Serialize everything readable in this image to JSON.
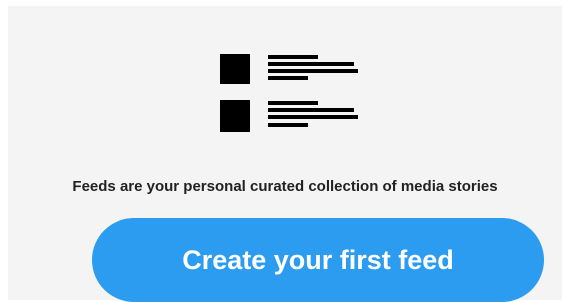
{
  "empty_state": {
    "icon": "feed-list-icon",
    "message": "Feeds are your personal curated collection of media stories",
    "cta_label": "Create your first feed",
    "accent_color": "#2c9cf0"
  }
}
